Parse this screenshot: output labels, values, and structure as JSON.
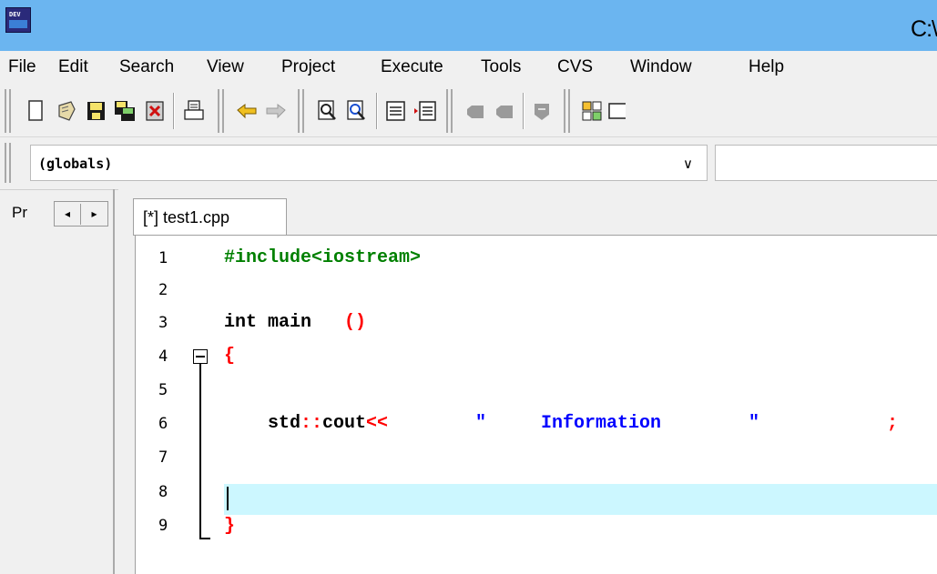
{
  "window": {
    "title": "C:\\",
    "app_icon_label": "DEV"
  },
  "menu": {
    "items": [
      "File",
      "Edit",
      "Search",
      "View",
      "Project",
      "Execute",
      "Tools",
      "CVS",
      "Window",
      "Help"
    ]
  },
  "toolbar": {
    "buttons": [
      "new-file-icon",
      "open-file-icon",
      "save-icon",
      "save-all-icon",
      "close-file-icon",
      "print-icon",
      "undo-icon",
      "redo-icon",
      "find-icon",
      "replace-icon",
      "unindent-icon",
      "indent-icon",
      "bookmark-icon",
      "goto-bookmark-icon",
      "toggle-bookmark-icon",
      "class-browser-icon",
      "window-icon"
    ]
  },
  "classbar": {
    "selected": "(globals)",
    "dropdown_arrow": "∨"
  },
  "left_panel": {
    "tab_label": "Pr",
    "nav_left": "◂",
    "nav_right": "▸"
  },
  "editor": {
    "tab_label": "[*] test1.cpp",
    "line_numbers": [
      "1",
      "2",
      "3",
      "4",
      "5",
      "6",
      "7",
      "8",
      "9"
    ],
    "lines": {
      "l1": "#include<iostream>",
      "l3_kw": "int main",
      "l3_paren": "()",
      "l4": "{",
      "l6_cout": "std",
      "l6_op1": "::",
      "l6_id": "cout",
      "l6_op2": "<<",
      "l6_str": "\"     Information        \"",
      "l6_semi": ";",
      "l9": "}"
    },
    "colors": {
      "preprocessor": "#008000",
      "keyword": "#000000",
      "symbol": "#ff0000",
      "string": "#0000ff",
      "current_line": "#ccf7ff"
    }
  }
}
